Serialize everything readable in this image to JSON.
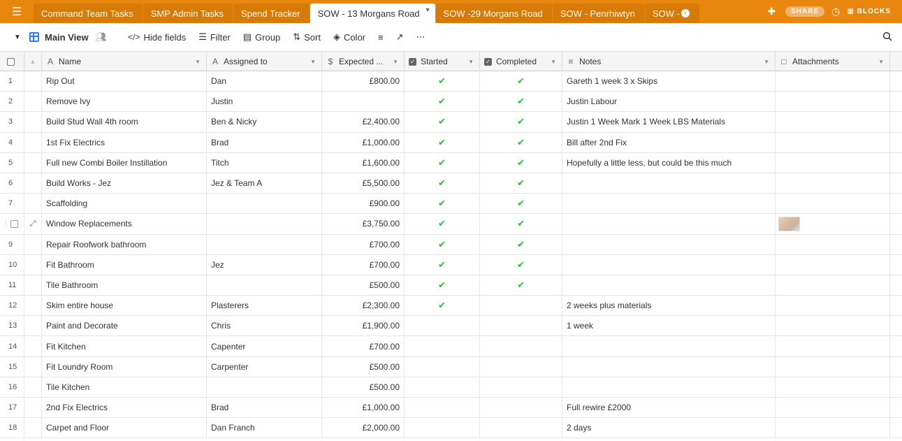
{
  "tabs": [
    {
      "label": "Command Team Tasks",
      "active": false
    },
    {
      "label": "SMP Admin Tasks",
      "active": false
    },
    {
      "label": "Spend Tracker",
      "active": false
    },
    {
      "label": "SOW - 13 Morgans Road",
      "active": true
    },
    {
      "label": "SOW -29 Morgans Road",
      "active": false
    },
    {
      "label": "SOW - Penrhiwtyn",
      "active": false
    },
    {
      "label": "SOW -",
      "active": false
    }
  ],
  "topbar": {
    "share_label": "SHARE",
    "blocks_label": "BLOCKS"
  },
  "toolbar": {
    "view_name": "Main View",
    "hide_fields": "Hide fields",
    "filter": "Filter",
    "group": "Group",
    "sort": "Sort",
    "color": "Color"
  },
  "columns": {
    "name": "Name",
    "assigned": "Assigned to",
    "expected": "Expected ...",
    "started": "Started",
    "completed": "Completed",
    "notes": "Notes",
    "attachments": "Attachments"
  },
  "rows": [
    {
      "num": "1",
      "name": "Rip Out",
      "assigned": "Dan",
      "expected": "£800.00",
      "started": true,
      "completed": true,
      "notes": "Gareth 1 week 3 x Skips",
      "attachment": false
    },
    {
      "num": "2",
      "name": "Remove Ivy",
      "assigned": "Justin",
      "expected": "",
      "started": true,
      "completed": true,
      "notes": "Justin Labour",
      "attachment": false
    },
    {
      "num": "3",
      "name": "Build Stud Wall 4th room",
      "assigned": "Ben & Nicky",
      "expected": "£2,400.00",
      "started": true,
      "completed": true,
      "notes": "Justin 1 Week Mark 1 Week LBS Materials",
      "attachment": false
    },
    {
      "num": "4",
      "name": "1st Fix Electrics",
      "assigned": "Brad",
      "expected": "£1,000.00",
      "started": true,
      "completed": true,
      "notes": "Bill after 2nd Fix",
      "attachment": false
    },
    {
      "num": "5",
      "name": "Full new Combi Boiler Instillation",
      "assigned": "Titch",
      "expected": "£1,600.00",
      "started": true,
      "completed": true,
      "notes": "Hopefully a little less, but could be this much",
      "attachment": false
    },
    {
      "num": "6",
      "name": "Build Works - Jez",
      "assigned": "Jez & Team A",
      "expected": "£5,500.00",
      "started": true,
      "completed": true,
      "notes": "",
      "attachment": false
    },
    {
      "num": "7",
      "name": "Scaffolding",
      "assigned": "",
      "expected": "£900.00",
      "started": true,
      "completed": true,
      "notes": "",
      "attachment": false
    },
    {
      "num": "",
      "name": "Window Replacements",
      "assigned": "",
      "expected": "£3,750.00",
      "started": true,
      "completed": true,
      "notes": "",
      "attachment": true,
      "hover": true
    },
    {
      "num": "9",
      "name": "Repair Roofwork bathroom",
      "assigned": "",
      "expected": "£700.00",
      "started": true,
      "completed": true,
      "notes": "",
      "attachment": false
    },
    {
      "num": "10",
      "name": "Fit Bathroom",
      "assigned": "Jez",
      "expected": "£700.00",
      "started": true,
      "completed": true,
      "notes": "",
      "attachment": false
    },
    {
      "num": "11",
      "name": "Tile Bathroom",
      "assigned": "",
      "expected": "£500.00",
      "started": true,
      "completed": true,
      "notes": "",
      "attachment": false
    },
    {
      "num": "12",
      "name": "Skim entire house",
      "assigned": "Plasterers",
      "expected": "£2,300.00",
      "started": true,
      "completed": false,
      "notes": "2 weeks plus materials",
      "attachment": false
    },
    {
      "num": "13",
      "name": "Paint and Decorate",
      "assigned": "Chris",
      "expected": "£1,900.00",
      "started": false,
      "completed": false,
      "notes": "1 week",
      "attachment": false
    },
    {
      "num": "14",
      "name": "Fit Kitchen",
      "assigned": "Capenter",
      "expected": "£700.00",
      "started": false,
      "completed": false,
      "notes": "",
      "attachment": false
    },
    {
      "num": "15",
      "name": "Fit Loundry Room",
      "assigned": "Carpenter",
      "expected": "£500.00",
      "started": false,
      "completed": false,
      "notes": "",
      "attachment": false
    },
    {
      "num": "16",
      "name": "Tile Kitchen",
      "assigned": "",
      "expected": "£500.00",
      "started": false,
      "completed": false,
      "notes": "",
      "attachment": false
    },
    {
      "num": "17",
      "name": "2nd Fix Electrics",
      "assigned": "Brad",
      "expected": "£1,000.00",
      "started": false,
      "completed": false,
      "notes": "Full rewire £2000",
      "attachment": false
    },
    {
      "num": "18",
      "name": "Carpet and Floor",
      "assigned": "Dan Franch",
      "expected": "£2,000.00",
      "started": false,
      "completed": false,
      "notes": "2 days",
      "attachment": false
    }
  ],
  "colors": {
    "tabbar": "#e8860e",
    "accent_blue": "#2d7ff9",
    "check_green": "#20c933"
  }
}
